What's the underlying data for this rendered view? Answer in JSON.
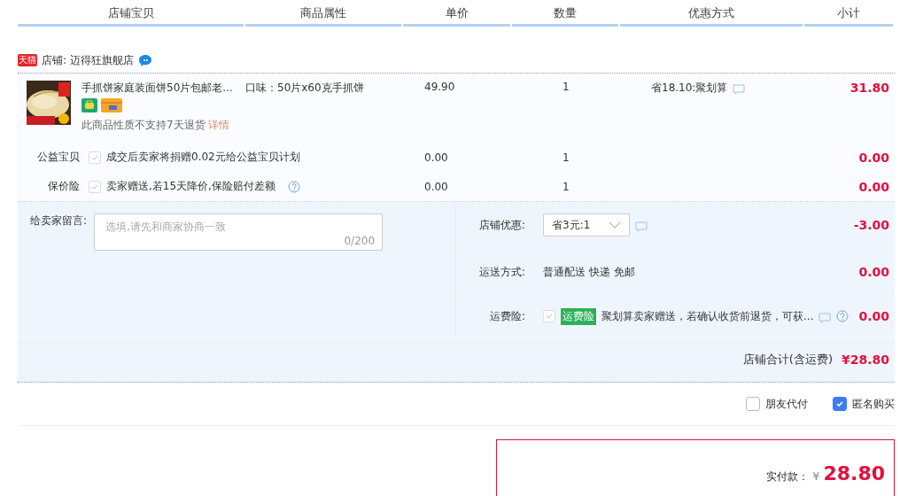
{
  "columns": [
    "店铺宝贝",
    "商品属性",
    "单价",
    "数量",
    "优惠方式",
    "小计"
  ],
  "shop": {
    "badge": "天猫",
    "name": "店铺: 迈得狂旗舰店"
  },
  "item": {
    "kind": "picture",
    "title": "手抓饼家庭装面饼50片包邮老...",
    "spec": "口味：50片x60克手抓饼",
    "price": "49.90",
    "qty": "1",
    "discount": "省18.10:聚划算",
    "subtotal": "31.80",
    "notice": "此商品性质不支持7天退货",
    "notice_link": "详情"
  },
  "services": [
    {
      "label": "公益宝贝",
      "checked": true,
      "text": "成交后卖家将捐赠0.02元给公益宝贝计划",
      "help": false,
      "price": "0.00",
      "qty": "1",
      "subtotal": "0.00"
    },
    {
      "label": "保价险",
      "checked": true,
      "text": "卖家赠送,若15天降价,保险赔付差额",
      "help": true,
      "price": "0.00",
      "qty": "1",
      "subtotal": "0.00"
    }
  ],
  "message": {
    "label": "给卖家留言:",
    "placeholder": "选填,请先和商家协商一致",
    "counter": "0/200"
  },
  "options": [
    {
      "kind": "select",
      "label": "店铺优惠:",
      "value": "省3元:1",
      "subtotal": "-3.00"
    },
    {
      "kind": "text",
      "label": "运送方式:",
      "value": "普通配送 快递 免邮",
      "subtotal": "0.00"
    },
    {
      "kind": "insurance",
      "label": "运费险:",
      "checked": true,
      "tag": "运费险",
      "value": "聚划算卖家赠送，若确认收货前退货，可获...",
      "subtotal": "0.00"
    }
  ],
  "total": {
    "label": "店铺合计(含运费)",
    "value": "¥28.80"
  },
  "checkboxes": [
    {
      "label": "朋友代付",
      "checked": false
    },
    {
      "label": "匿名购买",
      "checked": true
    }
  ],
  "payment": {
    "label": "实付款：",
    "currency": "¥",
    "amount": "28.80"
  }
}
